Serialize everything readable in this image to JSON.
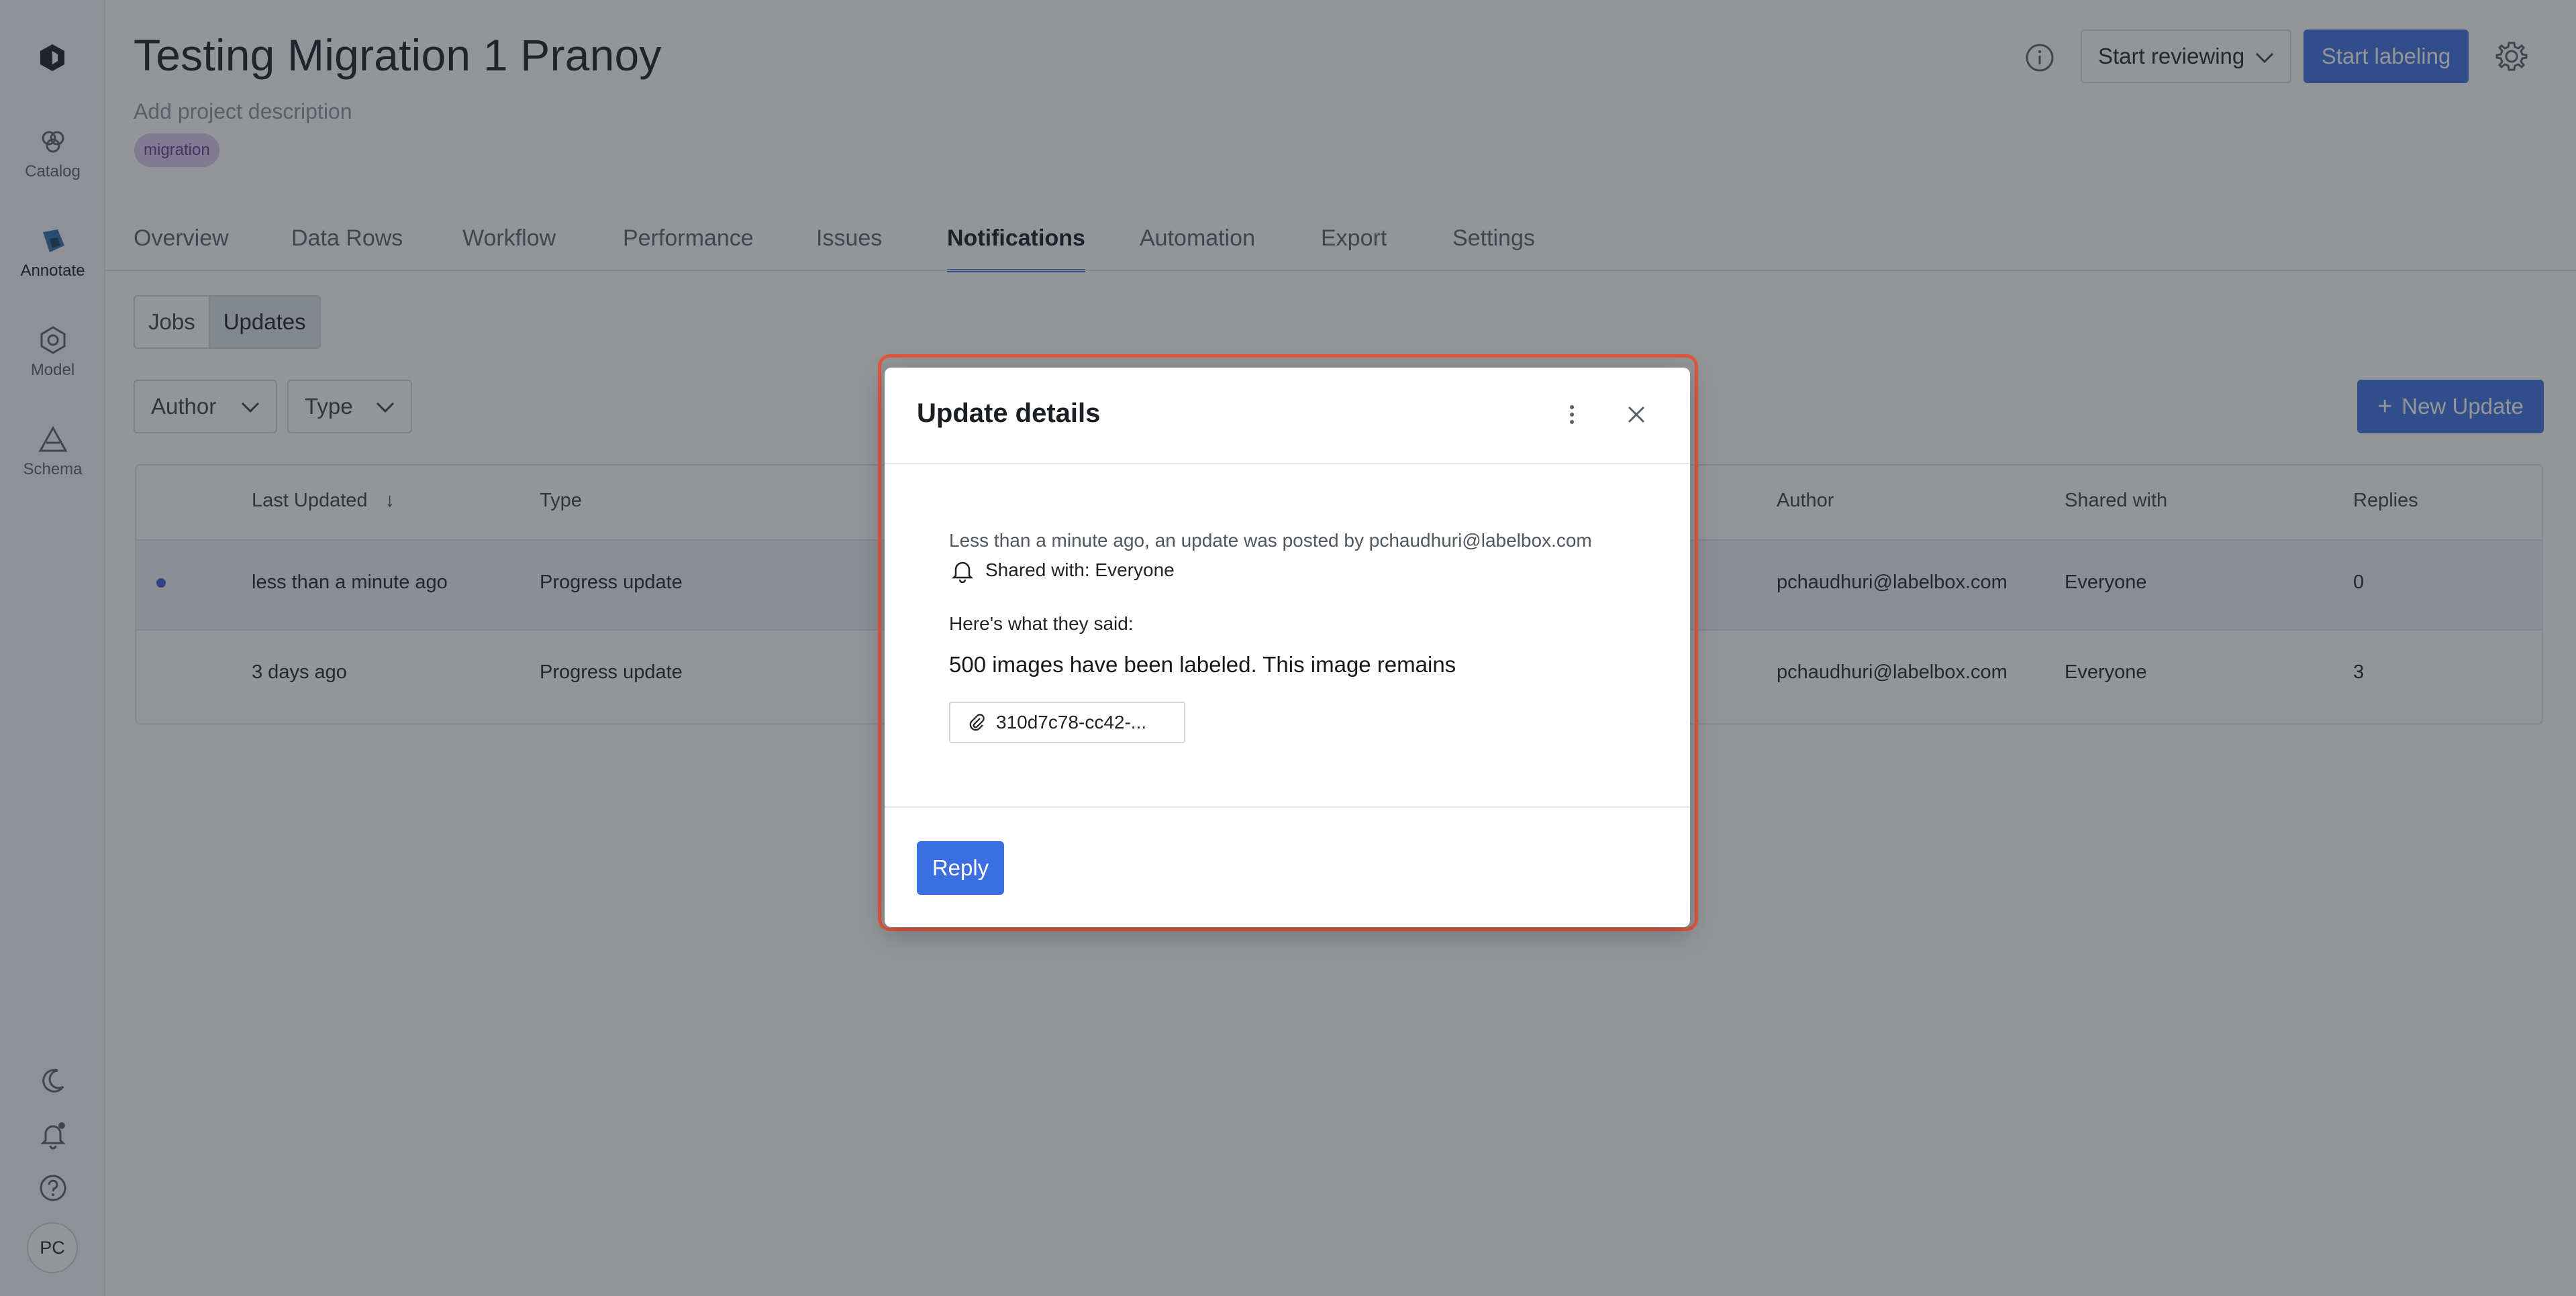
{
  "app": {
    "nav": [
      {
        "label": "Catalog",
        "icon": "catalog-icon"
      },
      {
        "label": "Annotate",
        "icon": "annotate-icon"
      },
      {
        "label": "Model",
        "icon": "model-icon"
      },
      {
        "label": "Schema",
        "icon": "schema-icon"
      }
    ],
    "avatar_initials": "PC"
  },
  "header": {
    "title": "Testing Migration 1 Pranoy",
    "description_placeholder": "Add project description",
    "tag": "migration",
    "start_reviewing": "Start reviewing",
    "start_labeling": "Start labeling"
  },
  "tabs": [
    "Overview",
    "Data Rows",
    "Workflow",
    "Performance",
    "Issues",
    "Notifications",
    "Automation",
    "Export",
    "Settings"
  ],
  "active_tab": "Notifications",
  "subtabs": {
    "jobs": "Jobs",
    "updates": "Updates"
  },
  "filters": {
    "author": "Author",
    "type": "Type"
  },
  "new_update_label": "New Update",
  "table": {
    "headers": {
      "last_updated": "Last Updated",
      "type": "Type",
      "author": "Author",
      "shared_with": "Shared with",
      "replies": "Replies"
    },
    "rows": [
      {
        "last_updated": "less than a minute ago",
        "type": "Progress update",
        "author": "pchaudhuri@labelbox.com",
        "shared_with": "Everyone",
        "replies": "0"
      },
      {
        "last_updated": "3 days ago",
        "type": "Progress update",
        "author": "pchaudhuri@labelbox.com",
        "shared_with": "Everyone",
        "replies": "3"
      }
    ]
  },
  "modal": {
    "title": "Update details",
    "meta": "Less than a minute ago, an update was posted by pchaudhuri@labelbox.com",
    "shared": "Shared with: Everyone",
    "said_label": "Here's what they said:",
    "message": "500 images have been labeled. This image remains",
    "attachment": "310d7c78-cc42-...",
    "reply_label": "Reply"
  },
  "colors": {
    "accent": "#3b6ee0",
    "modal_outline": "#e0583f",
    "tag_bg": "#d9c9f2"
  }
}
